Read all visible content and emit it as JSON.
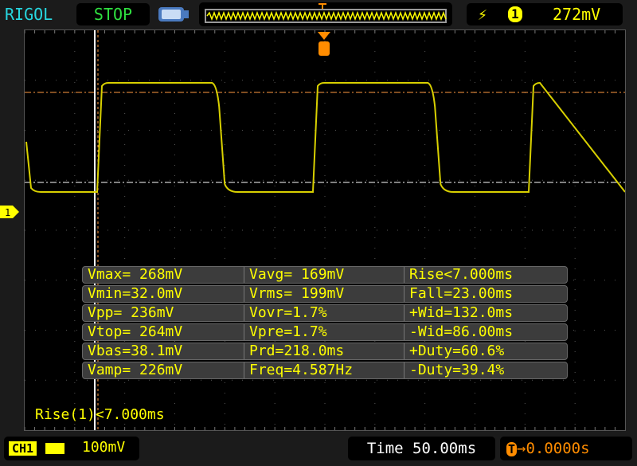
{
  "header": {
    "brand": "RIGOL",
    "run_status": "STOP",
    "trigger": {
      "edge_icon": "rising-edge-icon",
      "channel": "1",
      "level": "272mV"
    }
  },
  "colors": {
    "ch1": "#ffff00",
    "trigger": "#ff8c00",
    "cursor": "#ffffff",
    "brand": "#27d7e0",
    "status": "#2fe040"
  },
  "measurements": [
    [
      "Vmax= 268mV",
      "Vavg= 169mV",
      "Rise<7.000ms"
    ],
    [
      "Vmin=32.0mV",
      "Vrms= 199mV",
      "Fall=23.00ms"
    ],
    [
      "Vpp= 236mV",
      "Vovr=1.7%",
      "+Wid=132.0ms"
    ],
    [
      "Vtop= 264mV",
      "Vpre=1.7%",
      "-Wid=86.00ms"
    ],
    [
      "Vbas=38.1mV",
      "Prd=218.0ms",
      "+Duty=60.6%"
    ],
    [
      "Vamp= 226mV",
      "Freq=4.587Hz",
      "-Duty=39.4%"
    ]
  ],
  "cursor_readout": "Rise(1)<7.000ms",
  "footer": {
    "ch1_label": "CH1",
    "ch1_scale": "100mV",
    "timebase": "Time 50.00ms",
    "trigger_position": "0.0000s",
    "trigger_marker": "T"
  },
  "channel_marker": "1"
}
